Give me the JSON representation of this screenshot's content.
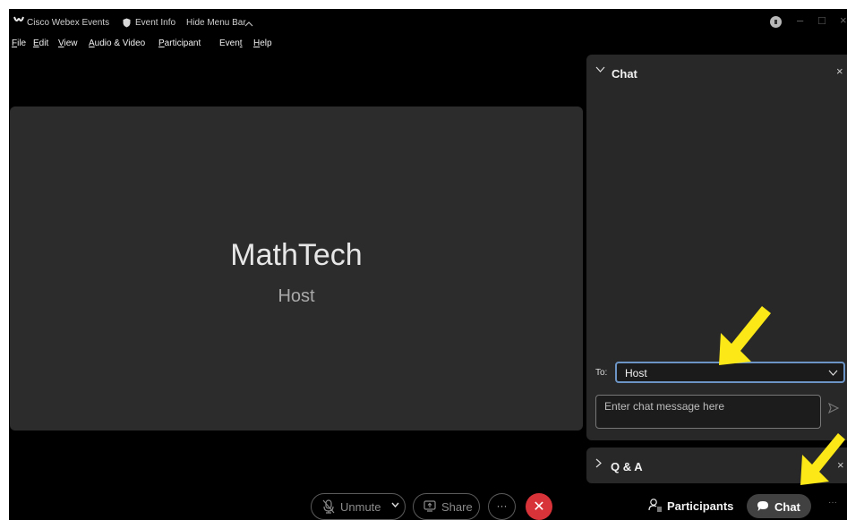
{
  "titlebar": {
    "app_name": "Cisco Webex Events",
    "event_info": "Event Info",
    "hide_menu_bar": "Hide Menu Bar",
    "min_glyph": "–",
    "max_glyph": "□",
    "close_glyph": "×"
  },
  "menu": {
    "file": {
      "u": "F",
      "rest": "ile"
    },
    "edit": {
      "u": "E",
      "rest": "dit"
    },
    "view": {
      "u": "V",
      "rest": "iew"
    },
    "audio_video": {
      "u": "A",
      "rest": "udio & Video"
    },
    "participant": {
      "u": "P",
      "rest": "articipant"
    },
    "event": {
      "pre": "Even",
      "u": "t",
      "rest": ""
    },
    "help": {
      "u": "H",
      "rest": "elp"
    }
  },
  "stage": {
    "name": "MathTech",
    "role": "Host"
  },
  "controls": {
    "unmute": "Unmute",
    "share": "Share",
    "more": "···",
    "end": "✕",
    "participants": "Participants",
    "chat": "Chat",
    "more_right": "···"
  },
  "chat_panel": {
    "title": "Chat",
    "to_label": "To:",
    "to_value": "Host",
    "message_placeholder": "Enter chat message here",
    "close_glyph": "×"
  },
  "qa_panel": {
    "title": "Q & A",
    "close_glyph": "×"
  },
  "colors": {
    "app_bg": "#000000",
    "stage_bg": "#2c2c2c",
    "panel_bg": "#282828",
    "end_call": "#d9333a",
    "focus_border": "#6c94c4",
    "annotation_arrow": "#fbe816"
  },
  "icons": {
    "logo": "webex-logo-icon",
    "event_info": "shield-icon",
    "hide_menu": "chevron-up-icon",
    "mic": "mic-muted-icon",
    "share": "share-screen-icon",
    "participants": "participants-icon",
    "chat": "chat-bubble-icon",
    "send": "send-icon"
  }
}
